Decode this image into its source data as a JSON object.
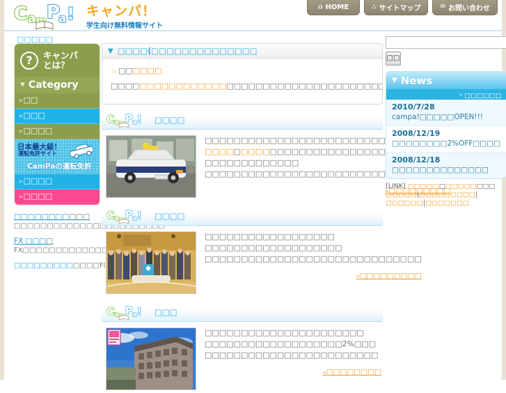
{
  "site": {
    "logo_text": "CamPa!",
    "title": "キャンパ！",
    "tagline": "学生向け無料情報サイト"
  },
  "header": {
    "nav": [
      {
        "label": "HOME",
        "icon": "home-icon",
        "glyph": "⌂"
      },
      {
        "label": "サイトマップ",
        "icon": "sitemap-icon",
        "glyph": "⛬"
      },
      {
        "label": "お問い合わせ",
        "icon": "mail-icon",
        "glyph": "✉"
      }
    ]
  },
  "breadcrumb": "□□□□□",
  "sidebar": {
    "whatis": {
      "label": "キャンパ\nとは？",
      "line1": "キャンパ",
      "line2": "とは？",
      "icon": "question-mark-icon"
    },
    "category_heading": "Category",
    "category_items": [
      {
        "label": "□□",
        "color": "#8a9e4b",
        "state": "normal"
      },
      {
        "label": "□□□",
        "color": "#21b3e8",
        "state": "active"
      },
      {
        "label": "□□□□",
        "color": "#8a9e4b",
        "state": "normal"
      }
    ],
    "banner": {
      "line1": "日本最大級！",
      "line2": "運転免許サイト",
      "line3": "CamPaの運転免許",
      "icon": "car-icon"
    },
    "category_items_bottom": [
      {
        "label": "□□□□",
        "color": "#21b3e8"
      },
      {
        "label": "□□□□",
        "color": "#fa4a8e"
      }
    ],
    "links": [
      {
        "title": "□□□□□□□□",
        "title_tail": "□□□",
        "desc": "□□□□□□□□□□□□□□□□□□□□□□□"
      },
      {
        "title": "FX □□□",
        "title_tail": "□",
        "desc": "FX□□□□□□□□□□□□□"
      }
    ],
    "flat_link": {
      "lead": "□□□□□□□□□",
      "mid": "□□□□",
      "tail": "Flashbook"
    }
  },
  "main": {
    "panel": {
      "heading": "□□□□(□□□□□□□□□□□□□□",
      "topic_star": "☆",
      "topic_title_plain": "□□",
      "topic_title_accent": "□□□□",
      "topic_line_a": "□□□□",
      "topic_line_b": "□□□□□□□□□□□□",
      "topic_line_c": "□□□□□□□□□□□□□□□□□□□□□□□□□□□□"
    },
    "sections": [
      {
        "logo": "CamPa!",
        "title": "□□□□",
        "thumb": "police-car-photo",
        "paragraphs": [
          {
            "parts": [
              {
                "t": "□□□□□□□□□□□□□□□□□□□□□□□□□□□□□□□□□□",
                "c": "gy"
              }
            ]
          },
          {
            "parts": [
              {
                "t": "□□□□",
                "c": "or"
              },
              {
                "t": "□",
                "c": "gy"
              },
              {
                "t": "□□□□",
                "c": "or"
              },
              {
                "t": "□□□□□□□□□□□□□□□□□□□ □□□□□□□□□□□□□",
                "c": "gy"
              }
            ]
          },
          {
            "parts": [
              {
                "t": "□□□□□□□□□□□□□□□□□□□□□□□□□□□□",
                "c": "gy"
              }
            ]
          }
        ],
        "more_label": "□□□□□□□□□"
      },
      {
        "logo": "CamPa!",
        "title": "□□□□",
        "thumb": "group-photo",
        "paragraphs": [
          {
            "parts": [
              {
                "t": "□□□□□□□□□□□□□□□□□□",
                "c": "gy"
              }
            ]
          },
          {
            "parts": [
              {
                "t": "□□□□□□□□□□□□□□□□□□□",
                "c": "gy"
              }
            ]
          },
          {
            "parts": [
              {
                "t": "□□□□□□□□□□□□□□□□□□□□□□□□□□□□□□",
                "c": "gy"
              }
            ]
          }
        ],
        "more_label": "□□□□□□□□□"
      },
      {
        "logo": "CamPa!",
        "title": "□□□",
        "thumb": "apartment-building-photo",
        "paragraphs": [
          {
            "parts": [
              {
                "t": "□□□□□□□□□□□□□□□□□□□□□□",
                "c": "gy"
              }
            ]
          },
          {
            "parts": [
              {
                "t": "□□□□□□□□□□□□□□□□□□□2%□□□",
                "c": "gy"
              }
            ]
          },
          {
            "parts": [
              {
                "t": "□□□□□□□□□□□□□□□□□□□□□□□□",
                "c": "gy"
              }
            ]
          }
        ],
        "more_label": "□□□□□□□□"
      }
    ]
  },
  "right": {
    "search": {
      "value": "",
      "placeholder": "",
      "button_label": "□□"
    },
    "news": {
      "heading": "News",
      "more_label": "・□□□□□□",
      "items": [
        {
          "date": "2010/7/28",
          "text": "campa!□□□□□OPEN!!!"
        },
        {
          "date": "2008/12/19",
          "text": "□□□□□□□□2%OFF□□□□"
        },
        {
          "date": "2008/12/18",
          "text": "□□□□□□□□□□□□□□"
        }
      ]
    },
    "linkline": {
      "tag": "[LINK]",
      "segments": [
        {
          "t": "□□□□□",
          "c": "or"
        },
        {
          "t": "□",
          "c": "gy"
        },
        {
          "t": "□□□□□",
          "c": "or"
        },
        {
          "t": "□□□",
          "c": "gy"
        },
        {
          "t": " □□□□□",
          "c": "or"
        },
        {
          "t": "|",
          "c": "gy"
        },
        {
          "t": "□□□□□□□□□",
          "c": "or"
        },
        {
          "t": "|",
          "c": "gy"
        },
        {
          "t": "□□□□□□",
          "c": "or"
        },
        {
          "t": "|",
          "c": "gy"
        },
        {
          "t": "□□□□□□□",
          "c": "or"
        }
      ]
    }
  },
  "colors": {
    "brand_orange": "#f5a623",
    "brand_blue": "#1a7fc1",
    "accent_cyan": "#29a8dd",
    "link_orange": "#f79b25",
    "sidebar_green": "#8a9e4b",
    "sidebar_blue": "#21b3e8",
    "sidebar_pink": "#fa4a8e",
    "nav_brown": "#8d856f"
  }
}
